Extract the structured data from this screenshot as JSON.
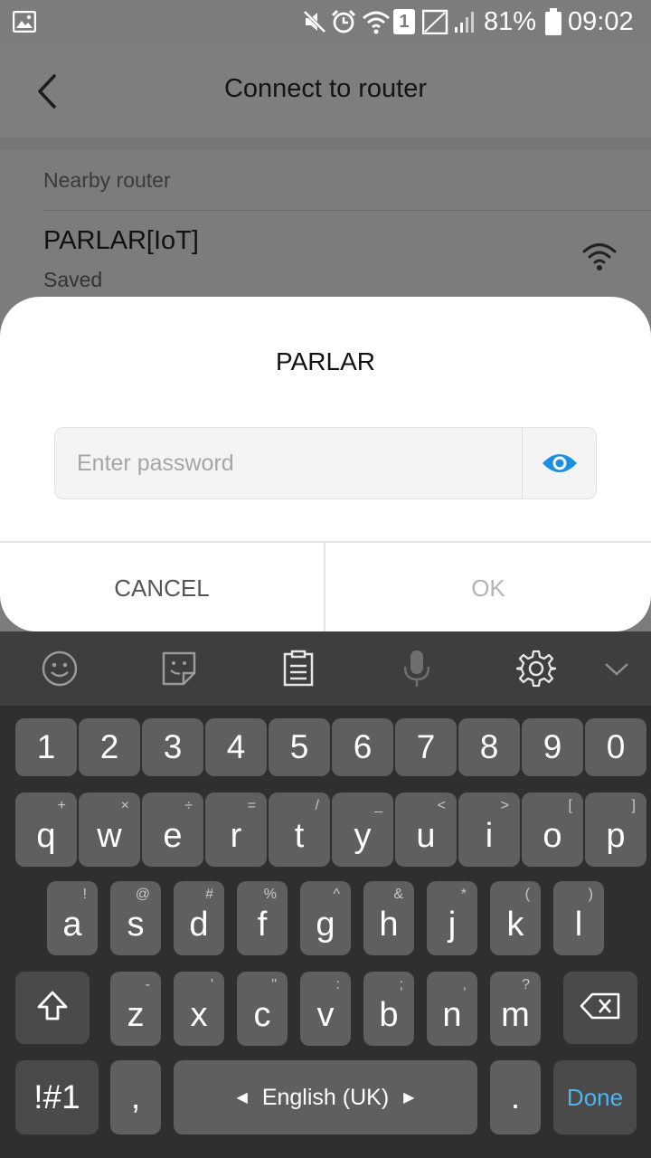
{
  "status_bar": {
    "battery_percent": "81%",
    "time": "09:02",
    "sim_slot": "1",
    "icons": [
      "gallery-notification-icon",
      "mute-icon",
      "alarm-icon",
      "wifi-icon",
      "sim-icon",
      "signal-icon",
      "battery-icon"
    ]
  },
  "app_bar": {
    "title": "Connect to router",
    "back_icon": "back-arrow-icon"
  },
  "router_list": {
    "section_header": "Nearby router",
    "items": [
      {
        "name": "PARLAR[IoT]",
        "status": "Saved",
        "icon": "wifi-signal-icon"
      }
    ]
  },
  "dialog": {
    "title": "PARLAR",
    "password_placeholder": "Enter password",
    "password_value": "",
    "visibility_icon": "eye-icon",
    "cancel_label": "CANCEL",
    "ok_label": "OK",
    "colors": {
      "eye_accent": "#1a8fe3",
      "ok_disabled": "#b4b4b4"
    }
  },
  "keyboard": {
    "toolbar_icons": [
      "emoji-icon",
      "sticker-icon",
      "clipboard-icon",
      "microphone-icon",
      "settings-icon",
      "collapse-chevron-icon"
    ],
    "number_row": [
      "1",
      "2",
      "3",
      "4",
      "5",
      "6",
      "7",
      "8",
      "9",
      "0"
    ],
    "row1": [
      {
        "key": "q",
        "alt": "+"
      },
      {
        "key": "w",
        "alt": "×"
      },
      {
        "key": "e",
        "alt": "÷"
      },
      {
        "key": "r",
        "alt": "="
      },
      {
        "key": "t",
        "alt": "/"
      },
      {
        "key": "y",
        "alt": "_"
      },
      {
        "key": "u",
        "alt": "<"
      },
      {
        "key": "i",
        "alt": ">"
      },
      {
        "key": "o",
        "alt": "["
      },
      {
        "key": "p",
        "alt": "]"
      }
    ],
    "row2": [
      {
        "key": "a",
        "alt": "!"
      },
      {
        "key": "s",
        "alt": "@"
      },
      {
        "key": "d",
        "alt": "#"
      },
      {
        "key": "f",
        "alt": "%"
      },
      {
        "key": "g",
        "alt": "^"
      },
      {
        "key": "h",
        "alt": "&"
      },
      {
        "key": "j",
        "alt": "*"
      },
      {
        "key": "k",
        "alt": "("
      },
      {
        "key": "l",
        "alt": ")"
      }
    ],
    "row3": [
      {
        "key": "z",
        "alt": "-"
      },
      {
        "key": "x",
        "alt": "'"
      },
      {
        "key": "c",
        "alt": "\""
      },
      {
        "key": "v",
        "alt": ":"
      },
      {
        "key": "b",
        "alt": ";"
      },
      {
        "key": "n",
        "alt": ","
      },
      {
        "key": "m",
        "alt": "?"
      }
    ],
    "symbols_label": "!#1",
    "comma_label": ",",
    "language_label": "English (UK)",
    "period_label": ".",
    "done_label": "Done",
    "shift_icon": "shift-icon",
    "backspace_icon": "backspace-icon",
    "colors": {
      "done_text": "#4fb3ec",
      "key_bg": "#5f5f5f",
      "keyboard_bg": "#2f2f2f"
    }
  }
}
